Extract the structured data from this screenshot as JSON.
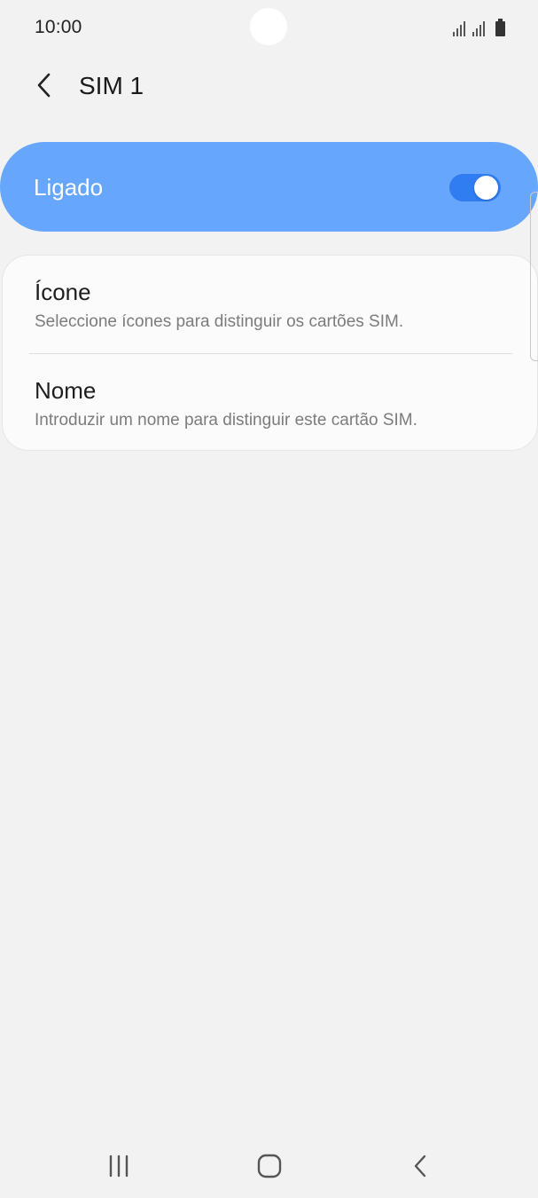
{
  "status_bar": {
    "time": "10:00",
    "icons": [
      "signal-icon",
      "signal-icon",
      "battery-icon"
    ]
  },
  "header": {
    "back_icon": "chevron-left-icon",
    "title": "SIM 1"
  },
  "master_switch": {
    "label": "Ligado",
    "enabled": true,
    "bar_color": "#66a6fd",
    "track_color": "#2f7df1"
  },
  "settings": {
    "items": [
      {
        "title": "Ícone",
        "subtitle": "Seleccione ícones para distinguir os cartões SIM."
      },
      {
        "title": "Nome",
        "subtitle": "Introduzir um nome para distinguir este cartão SIM."
      }
    ]
  },
  "nav_bar": {
    "icons": [
      "recent-apps-icon",
      "home-icon",
      "back-icon"
    ]
  }
}
